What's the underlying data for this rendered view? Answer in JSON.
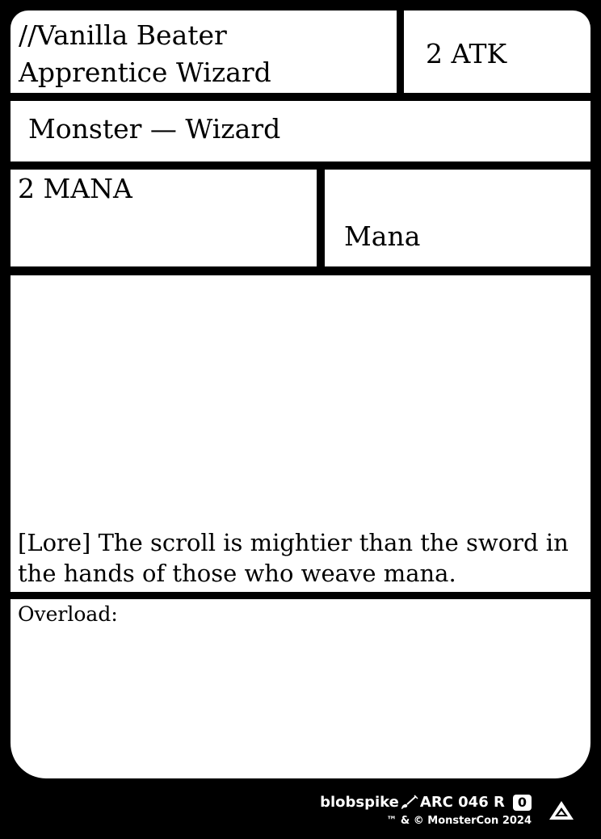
{
  "card": {
    "name_line1": "//Vanilla Beater",
    "name_line2": "Apprentice Wizard",
    "attack": "2 ATK",
    "type_line": "Monster — Wizard",
    "mana_cost": "2 MANA",
    "mana_type": "Mana",
    "lore": "[Lore] The scroll is mightier than the sword in the hands of those who weave mana.",
    "overload_label": "Overload:"
  },
  "footer": {
    "artist": "blobspike",
    "collector_info": "ARC 046 R",
    "rarity_badge": "0",
    "copyright": "™ & © MonsterCon 2024",
    "artist_icon": "paintbrush-icon",
    "logo_icon": "set-logo-icon"
  },
  "colors": {
    "frame": "#000000",
    "panel": "#ffffff"
  }
}
